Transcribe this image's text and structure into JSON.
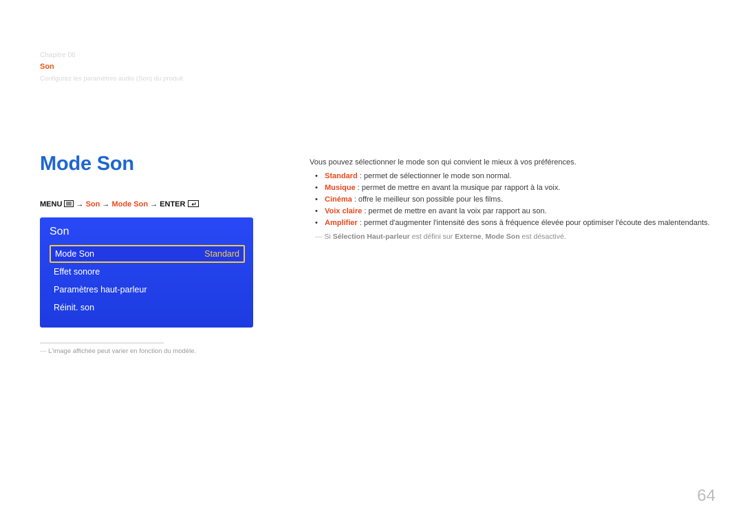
{
  "chapter": {
    "line1": "Chapitre 06",
    "line2b": "Son",
    "sub": "Configurez les paramètres audio (Son) du produit."
  },
  "page_title": "Mode Son",
  "nav_path": {
    "menu_label": "MENU",
    "seg1": "Son",
    "seg2": "Mode Son",
    "enter_label": "ENTER",
    "arrow": "→"
  },
  "osd": {
    "title": "Son",
    "rows": [
      {
        "label": "Mode Son",
        "value": "Standard",
        "selected": true
      },
      {
        "label": "Effet sonore",
        "value": "",
        "selected": false
      },
      {
        "label": "Paramètres haut-parleur",
        "value": "",
        "selected": false
      },
      {
        "label": "Réinit. son",
        "value": "",
        "selected": false
      }
    ]
  },
  "footnote": "L'image affichée peut varier en fonction du modèle.",
  "intro": "Vous pouvez sélectionner le mode son qui convient le mieux à vos préférences.",
  "options": [
    {
      "key": "Standard",
      "desc": " : permet de sélectionner le mode son normal."
    },
    {
      "key": "Musique",
      "desc": " : permet de mettre en avant la musique par rapport à la voix."
    },
    {
      "key": "Cinéma",
      "desc": " : offre le meilleur son possible pour les films."
    },
    {
      "key": "Voix claire",
      "desc": " : permet de mettre en avant la voix par rapport au son."
    },
    {
      "key": "Amplifier",
      "desc": " : permet d'augmenter l'intensité des sons à fréquence élevée pour optimiser l'écoute des malentendants."
    }
  ],
  "note": {
    "pre": "Si ",
    "b1": "Sélection Haut-parleur",
    "mid": " est défini sur ",
    "b2": "Externe",
    "mid2": ", ",
    "b3": "Mode Son",
    "post": " est désactivé."
  },
  "page_number": "64"
}
